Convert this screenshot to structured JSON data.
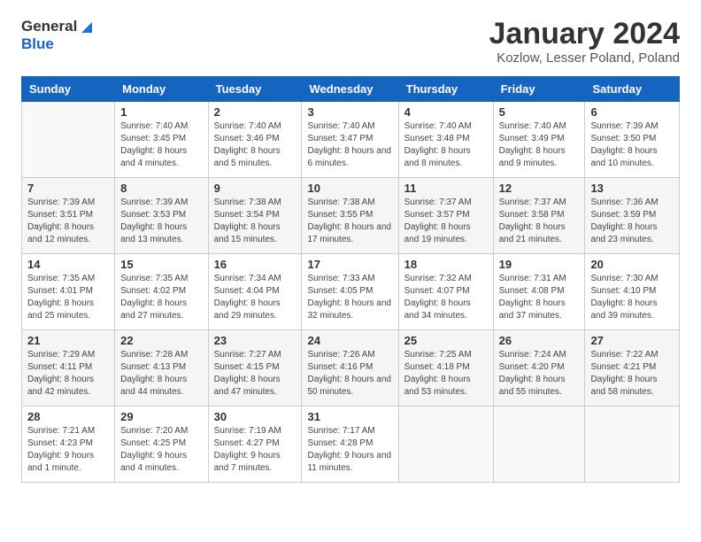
{
  "header": {
    "logo_line1": "General",
    "logo_line2": "Blue",
    "month_title": "January 2024",
    "location": "Kozlow, Lesser Poland, Poland"
  },
  "days_of_week": [
    "Sunday",
    "Monday",
    "Tuesday",
    "Wednesday",
    "Thursday",
    "Friday",
    "Saturday"
  ],
  "weeks": [
    [
      {
        "day": "",
        "sunrise": "",
        "sunset": "",
        "daylight": ""
      },
      {
        "day": "1",
        "sunrise": "Sunrise: 7:40 AM",
        "sunset": "Sunset: 3:45 PM",
        "daylight": "Daylight: 8 hours and 4 minutes."
      },
      {
        "day": "2",
        "sunrise": "Sunrise: 7:40 AM",
        "sunset": "Sunset: 3:46 PM",
        "daylight": "Daylight: 8 hours and 5 minutes."
      },
      {
        "day": "3",
        "sunrise": "Sunrise: 7:40 AM",
        "sunset": "Sunset: 3:47 PM",
        "daylight": "Daylight: 8 hours and 6 minutes."
      },
      {
        "day": "4",
        "sunrise": "Sunrise: 7:40 AM",
        "sunset": "Sunset: 3:48 PM",
        "daylight": "Daylight: 8 hours and 8 minutes."
      },
      {
        "day": "5",
        "sunrise": "Sunrise: 7:40 AM",
        "sunset": "Sunset: 3:49 PM",
        "daylight": "Daylight: 8 hours and 9 minutes."
      },
      {
        "day": "6",
        "sunrise": "Sunrise: 7:39 AM",
        "sunset": "Sunset: 3:50 PM",
        "daylight": "Daylight: 8 hours and 10 minutes."
      }
    ],
    [
      {
        "day": "7",
        "sunrise": "Sunrise: 7:39 AM",
        "sunset": "Sunset: 3:51 PM",
        "daylight": "Daylight: 8 hours and 12 minutes."
      },
      {
        "day": "8",
        "sunrise": "Sunrise: 7:39 AM",
        "sunset": "Sunset: 3:53 PM",
        "daylight": "Daylight: 8 hours and 13 minutes."
      },
      {
        "day": "9",
        "sunrise": "Sunrise: 7:38 AM",
        "sunset": "Sunset: 3:54 PM",
        "daylight": "Daylight: 8 hours and 15 minutes."
      },
      {
        "day": "10",
        "sunrise": "Sunrise: 7:38 AM",
        "sunset": "Sunset: 3:55 PM",
        "daylight": "Daylight: 8 hours and 17 minutes."
      },
      {
        "day": "11",
        "sunrise": "Sunrise: 7:37 AM",
        "sunset": "Sunset: 3:57 PM",
        "daylight": "Daylight: 8 hours and 19 minutes."
      },
      {
        "day": "12",
        "sunrise": "Sunrise: 7:37 AM",
        "sunset": "Sunset: 3:58 PM",
        "daylight": "Daylight: 8 hours and 21 minutes."
      },
      {
        "day": "13",
        "sunrise": "Sunrise: 7:36 AM",
        "sunset": "Sunset: 3:59 PM",
        "daylight": "Daylight: 8 hours and 23 minutes."
      }
    ],
    [
      {
        "day": "14",
        "sunrise": "Sunrise: 7:35 AM",
        "sunset": "Sunset: 4:01 PM",
        "daylight": "Daylight: 8 hours and 25 minutes."
      },
      {
        "day": "15",
        "sunrise": "Sunrise: 7:35 AM",
        "sunset": "Sunset: 4:02 PM",
        "daylight": "Daylight: 8 hours and 27 minutes."
      },
      {
        "day": "16",
        "sunrise": "Sunrise: 7:34 AM",
        "sunset": "Sunset: 4:04 PM",
        "daylight": "Daylight: 8 hours and 29 minutes."
      },
      {
        "day": "17",
        "sunrise": "Sunrise: 7:33 AM",
        "sunset": "Sunset: 4:05 PM",
        "daylight": "Daylight: 8 hours and 32 minutes."
      },
      {
        "day": "18",
        "sunrise": "Sunrise: 7:32 AM",
        "sunset": "Sunset: 4:07 PM",
        "daylight": "Daylight: 8 hours and 34 minutes."
      },
      {
        "day": "19",
        "sunrise": "Sunrise: 7:31 AM",
        "sunset": "Sunset: 4:08 PM",
        "daylight": "Daylight: 8 hours and 37 minutes."
      },
      {
        "day": "20",
        "sunrise": "Sunrise: 7:30 AM",
        "sunset": "Sunset: 4:10 PM",
        "daylight": "Daylight: 8 hours and 39 minutes."
      }
    ],
    [
      {
        "day": "21",
        "sunrise": "Sunrise: 7:29 AM",
        "sunset": "Sunset: 4:11 PM",
        "daylight": "Daylight: 8 hours and 42 minutes."
      },
      {
        "day": "22",
        "sunrise": "Sunrise: 7:28 AM",
        "sunset": "Sunset: 4:13 PM",
        "daylight": "Daylight: 8 hours and 44 minutes."
      },
      {
        "day": "23",
        "sunrise": "Sunrise: 7:27 AM",
        "sunset": "Sunset: 4:15 PM",
        "daylight": "Daylight: 8 hours and 47 minutes."
      },
      {
        "day": "24",
        "sunrise": "Sunrise: 7:26 AM",
        "sunset": "Sunset: 4:16 PM",
        "daylight": "Daylight: 8 hours and 50 minutes."
      },
      {
        "day": "25",
        "sunrise": "Sunrise: 7:25 AM",
        "sunset": "Sunset: 4:18 PM",
        "daylight": "Daylight: 8 hours and 53 minutes."
      },
      {
        "day": "26",
        "sunrise": "Sunrise: 7:24 AM",
        "sunset": "Sunset: 4:20 PM",
        "daylight": "Daylight: 8 hours and 55 minutes."
      },
      {
        "day": "27",
        "sunrise": "Sunrise: 7:22 AM",
        "sunset": "Sunset: 4:21 PM",
        "daylight": "Daylight: 8 hours and 58 minutes."
      }
    ],
    [
      {
        "day": "28",
        "sunrise": "Sunrise: 7:21 AM",
        "sunset": "Sunset: 4:23 PM",
        "daylight": "Daylight: 9 hours and 1 minute."
      },
      {
        "day": "29",
        "sunrise": "Sunrise: 7:20 AM",
        "sunset": "Sunset: 4:25 PM",
        "daylight": "Daylight: 9 hours and 4 minutes."
      },
      {
        "day": "30",
        "sunrise": "Sunrise: 7:19 AM",
        "sunset": "Sunset: 4:27 PM",
        "daylight": "Daylight: 9 hours and 7 minutes."
      },
      {
        "day": "31",
        "sunrise": "Sunrise: 7:17 AM",
        "sunset": "Sunset: 4:28 PM",
        "daylight": "Daylight: 9 hours and 11 minutes."
      },
      {
        "day": "",
        "sunrise": "",
        "sunset": "",
        "daylight": ""
      },
      {
        "day": "",
        "sunrise": "",
        "sunset": "",
        "daylight": ""
      },
      {
        "day": "",
        "sunrise": "",
        "sunset": "",
        "daylight": ""
      }
    ]
  ]
}
